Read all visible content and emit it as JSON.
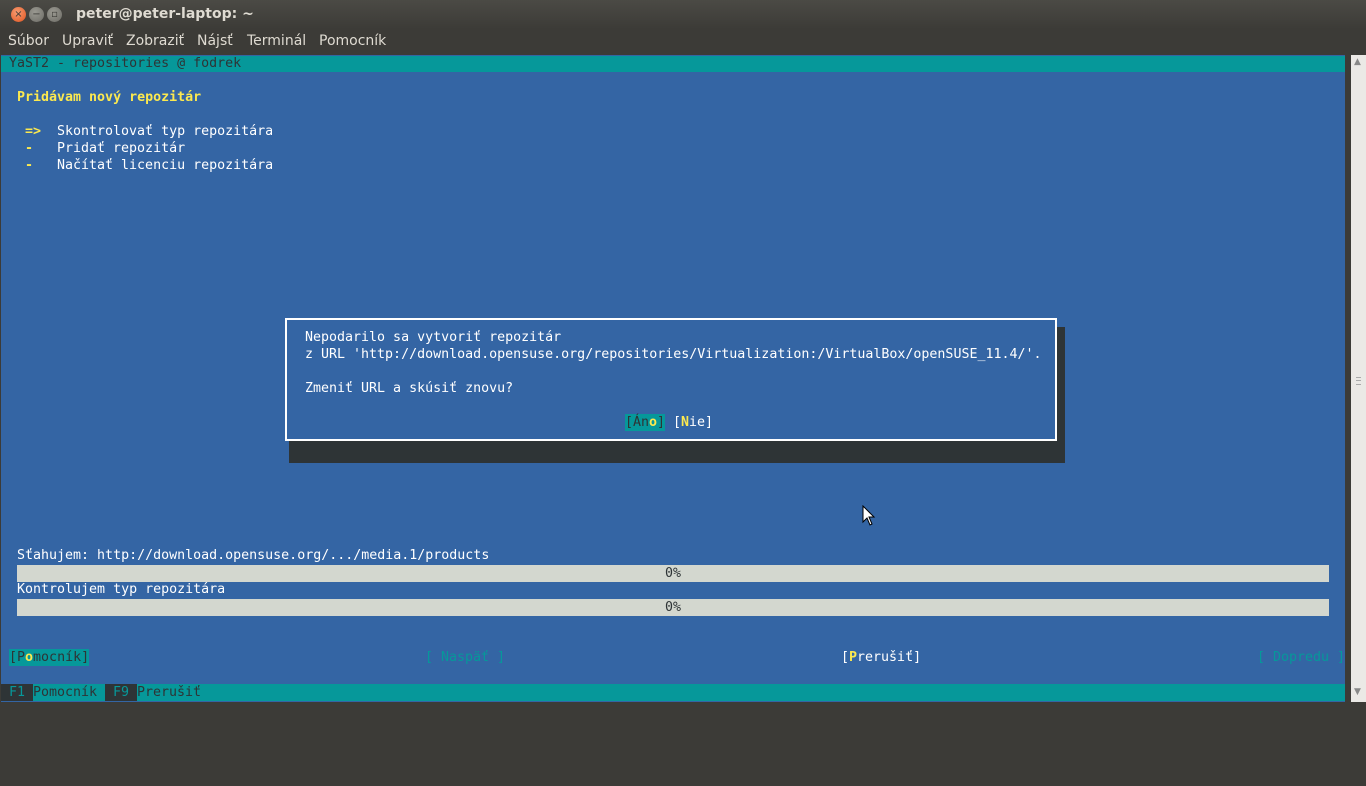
{
  "window": {
    "title": "peter@peter-laptop: ~"
  },
  "menu": [
    "Súbor",
    "Upraviť",
    "Zobraziť",
    "Nájsť",
    "Terminál",
    "Pomocník"
  ],
  "yast": {
    "header": "YaST2 - repositories @ fodrek",
    "heading": "Pridávam nový repozitár",
    "steps": [
      {
        "marker": "=>",
        "label": "Skontrolovať typ repozitára"
      },
      {
        "marker": "-",
        "label": "Pridať repozitár"
      },
      {
        "marker": "-",
        "label": "Načítať licenciu repozitára"
      }
    ],
    "dialog": {
      "line1": "Nepodarilo sa vytvoriť repozitár",
      "line2": "z URL 'http://download.opensuse.org/repositories/Virtualization:/VirtualBox/openSUSE_11.4/'.",
      "question": "Zmeniť URL a skúsiť znovu?",
      "yes": {
        "open": "[",
        "pre": "Án",
        "hotkey": "o",
        "close": "]"
      },
      "no": {
        "open": "[",
        "hotkey": "N",
        "post": "ie",
        "close": "]"
      }
    },
    "progress": [
      {
        "label": "Sťahujem: http://download.opensuse.org/.../media.1/products",
        "value_text": "0%",
        "value": 0
      },
      {
        "label": "Kontrolujem typ repozitára",
        "value_text": "0%",
        "value": 0
      }
    ],
    "buttons": {
      "help": {
        "open": "[",
        "pre": "P",
        "hotkey": "o",
        "post": "mocník",
        "close": "]"
      },
      "back": "[ Naspäť ]",
      "abort": {
        "open": "[",
        "hotkey": "P",
        "post": "rerušiť",
        "close": "]"
      },
      "next": "[ Dopredu ]"
    },
    "fkeys": [
      {
        "key": "F1",
        "label": "Pomocník"
      },
      {
        "key": "F9",
        "label": "Prerušiť"
      }
    ]
  },
  "colors": {
    "terminal_bg": "#3465a4",
    "cyan": "#06989a",
    "yellow": "#fce94f",
    "progress_bg": "#d3d7cf"
  }
}
